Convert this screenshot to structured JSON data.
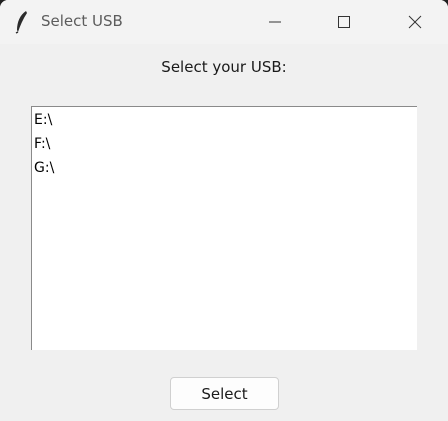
{
  "window": {
    "title": "Select USB",
    "icon": "feather-icon"
  },
  "controls": {
    "minimize_icon": "minimize-icon",
    "maximize_icon": "maximize-icon",
    "close_icon": "close-icon"
  },
  "main": {
    "heading": "Select your USB:",
    "drives": [
      "E:\\",
      "F:\\",
      "G:\\"
    ],
    "select_label": "Select"
  }
}
